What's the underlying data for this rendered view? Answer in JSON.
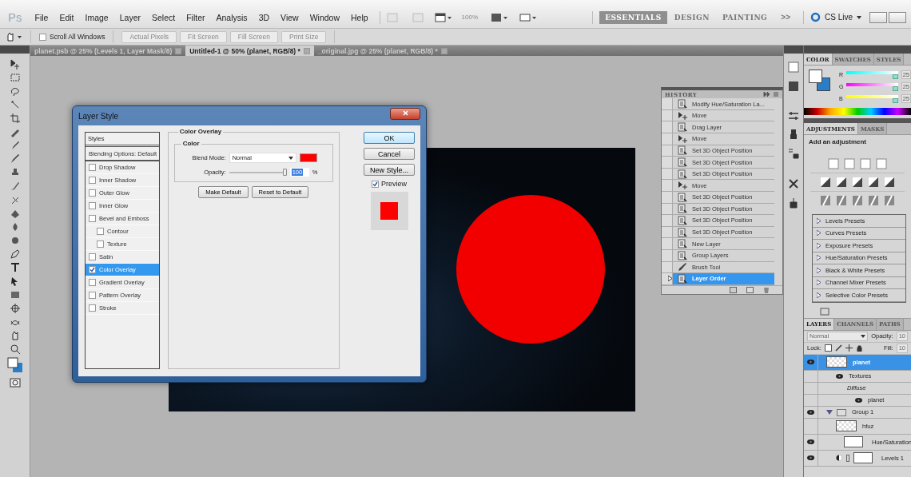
{
  "app_logo": "Ps",
  "menu": [
    "File",
    "Edit",
    "Image",
    "Layer",
    "Select",
    "Filter",
    "Analysis",
    "3D",
    "View",
    "Window",
    "Help"
  ],
  "app_bar": {
    "zoom": "100%"
  },
  "workspaces": [
    {
      "label": "ESSENTIALS",
      "selected": true
    },
    {
      "label": "DESIGN",
      "selected": false
    },
    {
      "label": "PAINTING",
      "selected": false
    }
  ],
  "more_workspaces": ">>",
  "cs_live": "CS Live",
  "options_bar": {
    "scroll_all_windows": {
      "label": "Scroll All Windows",
      "checked": false
    },
    "buttons": [
      "Actual Pixels",
      "Fit Screen",
      "Fill Screen",
      "Print Size"
    ]
  },
  "document_tabs": [
    {
      "label": "planet.psb @ 25% (Levels 1, Layer Mask/8)",
      "selected": false
    },
    {
      "label": "Untitled-1 @ 50% (planet, RGB/8) *",
      "selected": true
    },
    {
      "label": "_original.jpg @ 25% (planet, RGB/8) *",
      "selected": false
    }
  ],
  "layer_style": {
    "title": "Layer Style",
    "styles_header": "Styles",
    "blending_options": "Blending Options: Default",
    "effects": [
      {
        "label": "Drop Shadow",
        "kind": "effect",
        "checked": false,
        "selected": false
      },
      {
        "label": "Inner Shadow",
        "kind": "effect",
        "checked": false,
        "selected": false
      },
      {
        "label": "Outer Glow",
        "kind": "effect",
        "checked": false,
        "selected": false
      },
      {
        "label": "Inner Glow",
        "kind": "effect",
        "checked": false,
        "selected": false
      },
      {
        "label": "Bevel and Emboss",
        "kind": "effect",
        "checked": false,
        "selected": false
      },
      {
        "label": "Contour",
        "kind": "sub",
        "checked": false,
        "selected": false
      },
      {
        "label": "Texture",
        "kind": "sub",
        "checked": false,
        "selected": false
      },
      {
        "label": "Satin",
        "kind": "effect",
        "checked": false,
        "selected": false
      },
      {
        "label": "Color Overlay",
        "kind": "effect",
        "checked": true,
        "selected": true
      },
      {
        "label": "Gradient Overlay",
        "kind": "effect",
        "checked": false,
        "selected": false
      },
      {
        "label": "Pattern Overlay",
        "kind": "effect",
        "checked": false,
        "selected": false
      },
      {
        "label": "Stroke",
        "kind": "effect",
        "checked": false,
        "selected": false
      }
    ],
    "section_title": "Color Overlay",
    "group_title": "Color",
    "blend_mode_label": "Blend Mode:",
    "blend_mode": "Normal",
    "opacity_label": "Opacity:",
    "opacity": {
      "level": 1,
      "value": "100"
    },
    "percent": "%",
    "make_default": "Make Default",
    "reset_default": "Reset to Default",
    "buttons": [
      "OK",
      "Cancel",
      "New Style..."
    ],
    "preview": {
      "label": "Preview",
      "checked": true
    }
  },
  "history": {
    "title": "HISTORY",
    "items": [
      {
        "label": "Modify Hue/Saturation La...",
        "kind": "doc",
        "selected": false
      },
      {
        "label": "Move",
        "kind": "move",
        "selected": false
      },
      {
        "label": "Drag Layer",
        "kind": "doc",
        "selected": false
      },
      {
        "label": "Move",
        "kind": "move",
        "selected": false
      },
      {
        "label": "Set 3D Object Position",
        "kind": "doc",
        "selected": false
      },
      {
        "label": "Set 3D Object Position",
        "kind": "doc",
        "selected": false
      },
      {
        "label": "Set 3D Object Position",
        "kind": "doc",
        "selected": false
      },
      {
        "label": "Move",
        "kind": "move",
        "selected": false
      },
      {
        "label": "Set 3D Object Position",
        "kind": "doc",
        "selected": false
      },
      {
        "label": "Set 3D Object Position",
        "kind": "doc",
        "selected": false
      },
      {
        "label": "Set 3D Object Position",
        "kind": "doc",
        "selected": false
      },
      {
        "label": "Set 3D Object Position",
        "kind": "doc",
        "selected": false
      },
      {
        "label": "New Layer",
        "kind": "doc",
        "selected": false
      },
      {
        "label": "Group Layers",
        "kind": "doc",
        "selected": false
      },
      {
        "label": "Brush Tool",
        "kind": "brush",
        "selected": false
      },
      {
        "label": "Layer Order",
        "kind": "doc",
        "selected": true
      }
    ]
  },
  "color_panel": {
    "tabs": [
      {
        "label": "COLOR",
        "selected": true
      },
      {
        "label": "SWATCHES",
        "selected": false
      },
      {
        "label": "STYLES",
        "selected": false
      }
    ],
    "channels": [
      {
        "label": "R",
        "value": "25",
        "level": 1
      },
      {
        "label": "G",
        "value": "25",
        "level": 1
      },
      {
        "label": "B",
        "value": "25",
        "level": 1
      }
    ]
  },
  "adjustments": {
    "tabs": [
      {
        "label": "ADJUSTMENTS",
        "selected": true
      },
      {
        "label": "MASKS",
        "selected": false
      }
    ],
    "heading": "Add an adjustment",
    "presets": [
      "Levels Presets",
      "Curves Presets",
      "Exposure Presets",
      "Hue/Saturation Presets",
      "Black & White Presets",
      "Channel Mixer Presets",
      "Selective Color Presets"
    ]
  },
  "layers": {
    "tabs": [
      {
        "label": "LAYERS",
        "selected": true
      },
      {
        "label": "CHANNELS",
        "selected": false
      },
      {
        "label": "PATHS",
        "selected": false
      }
    ],
    "blend_mode": "Normal",
    "opacity_label": "Opacity:",
    "opacity": "10",
    "lock_label": "Lock:",
    "fill_label": "Fill:",
    "fill": "10",
    "items": [
      {
        "name": "planet",
        "kind": "smart",
        "visible": true,
        "selected": true,
        "children": [
          {
            "name": "Textures",
            "kind": "effects",
            "visible": true,
            "selected": false,
            "children": [
              {
                "name": "Diffuse",
                "kind": "texture",
                "selected": false,
                "children": [
                  {
                    "name": "planet",
                    "kind": "sublayer",
                    "visible": true,
                    "selected": false
                  }
                ]
              }
            ]
          }
        ]
      },
      {
        "name": "Group 1",
        "kind": "group",
        "visible": true,
        "selected": false,
        "expanded": true,
        "children": [
          {
            "name": "hfuz",
            "kind": "layer",
            "visible": false,
            "selected": false
          },
          {
            "name": "Hue/Saturation",
            "kind": "adjustment",
            "visible": true,
            "selected": false
          },
          {
            "name": "Levels 1",
            "kind": "adjustment",
            "visible": true,
            "selected": false
          }
        ]
      }
    ]
  }
}
